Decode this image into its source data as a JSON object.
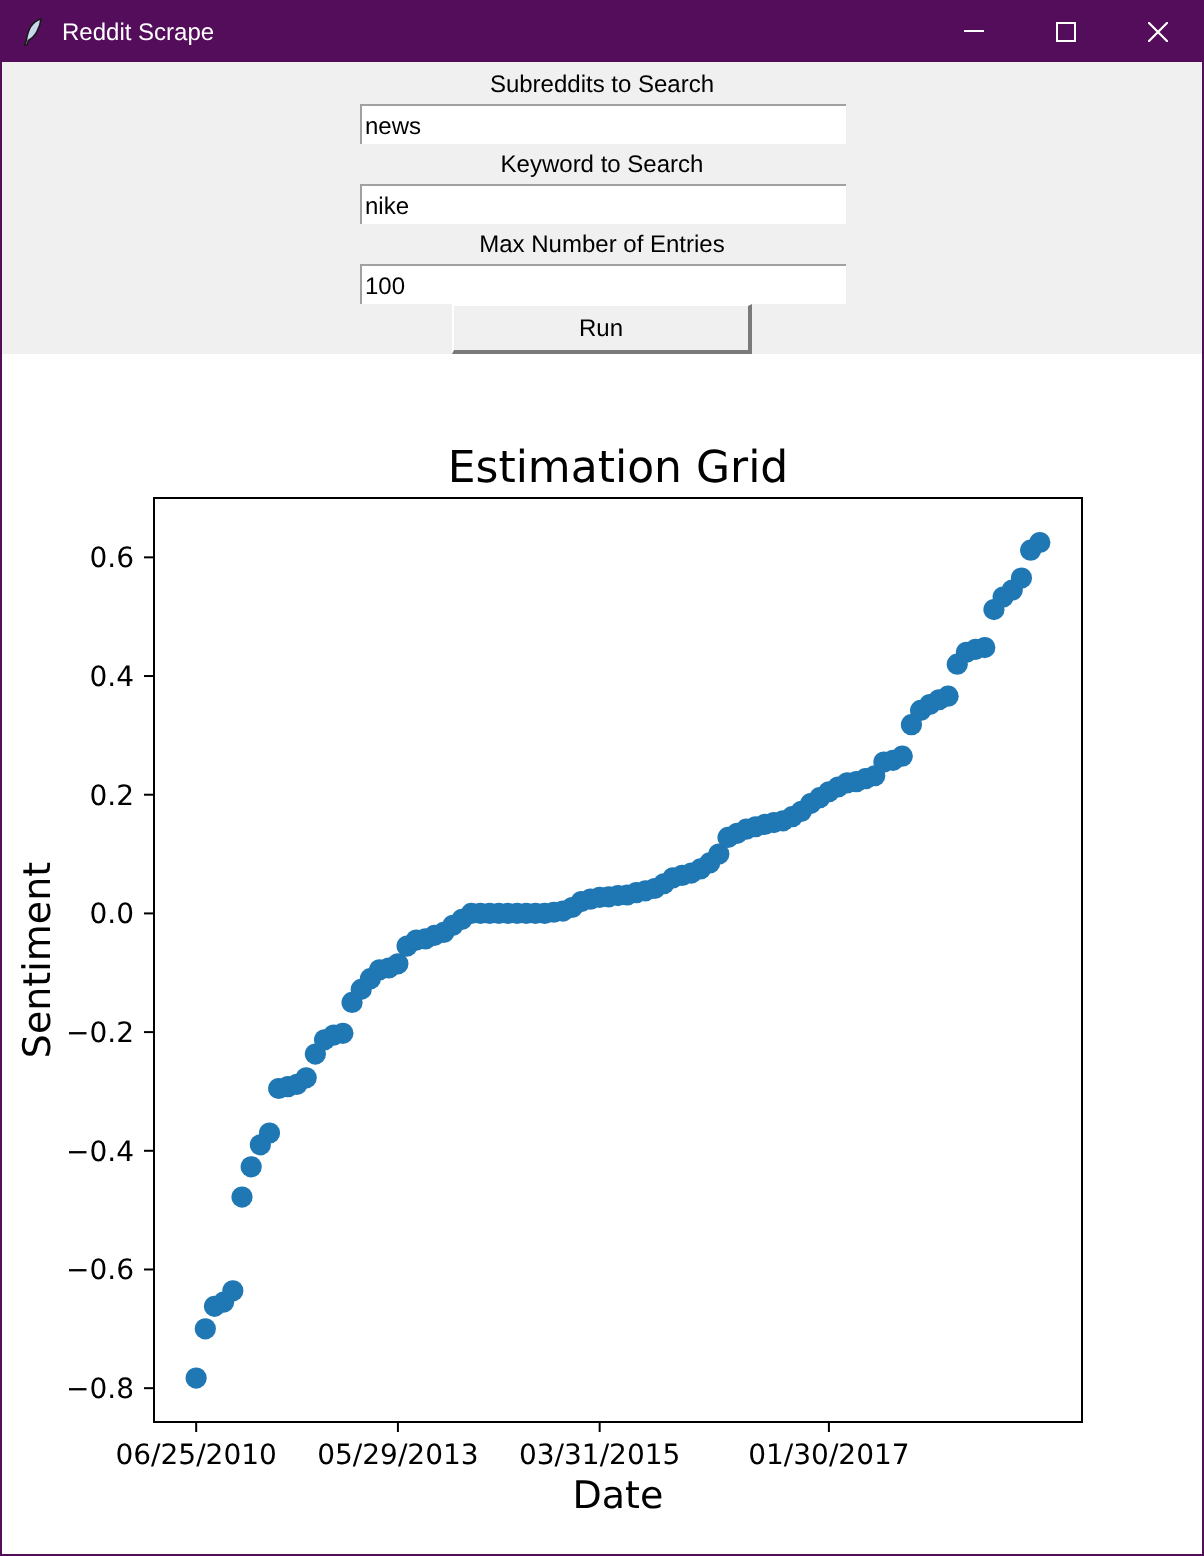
{
  "window": {
    "title": "Reddit Scrape"
  },
  "form": {
    "fields": [
      {
        "label": "Subreddits to Search",
        "value": "news"
      },
      {
        "label": "Keyword to Search",
        "value": "nike"
      },
      {
        "label": "Max Number of Entries",
        "value": "100"
      }
    ],
    "run_button": "Run"
  },
  "chart": {
    "chart_data": {
      "type": "scatter",
      "title": "Estimation Grid",
      "xlabel": "Date",
      "ylabel": "Sentiment",
      "categories": [
        "06/25/2010",
        null,
        null,
        null,
        null,
        null,
        null,
        null,
        null,
        null,
        null,
        null,
        null,
        null,
        null,
        null,
        null,
        null,
        null,
        null,
        null,
        null,
        "05/29/2013",
        null,
        null,
        null,
        null,
        null,
        null,
        null,
        null,
        null,
        null,
        null,
        null,
        null,
        null,
        null,
        null,
        null,
        null,
        null,
        null,
        null,
        "03/31/2015",
        null,
        null,
        null,
        null,
        null,
        null,
        null,
        null,
        null,
        null,
        null,
        null,
        null,
        null,
        null,
        null,
        null,
        null,
        null,
        null,
        null,
        null,
        null,
        null,
        "01/30/2017",
        null,
        null,
        null,
        null,
        null,
        null,
        null,
        null,
        null,
        null,
        null,
        null,
        null,
        null,
        null,
        null,
        null,
        null,
        null,
        null,
        null,
        null,
        null
      ],
      "series": [
        {
          "color": "#1f77b4",
          "values": [
            -0.783,
            -0.7,
            -0.662,
            -0.655,
            -0.636,
            -0.478,
            -0.427,
            -0.39,
            -0.37,
            -0.295,
            -0.292,
            -0.288,
            -0.277,
            -0.237,
            -0.213,
            -0.205,
            -0.202,
            -0.15,
            -0.128,
            -0.11,
            -0.095,
            -0.092,
            -0.085,
            -0.055,
            -0.045,
            -0.043,
            -0.037,
            -0.032,
            -0.02,
            -0.01,
            0.0,
            0.0,
            0.0,
            0.0,
            0.0,
            0.0,
            0.0,
            0.0,
            0.0,
            0.002,
            0.004,
            0.01,
            0.02,
            0.024,
            0.027,
            0.028,
            0.03,
            0.031,
            0.035,
            0.038,
            0.042,
            0.05,
            0.06,
            0.064,
            0.068,
            0.075,
            0.085,
            0.1,
            0.128,
            0.135,
            0.142,
            0.146,
            0.15,
            0.153,
            0.156,
            0.163,
            0.172,
            0.185,
            0.195,
            0.205,
            0.213,
            0.22,
            0.222,
            0.227,
            0.232,
            0.255,
            0.258,
            0.265,
            0.318,
            0.342,
            0.352,
            0.36,
            0.366,
            0.42,
            0.44,
            0.445,
            0.448,
            0.512,
            0.533,
            0.545,
            0.565,
            0.612,
            0.625
          ]
        }
      ],
      "ylim": [
        -0.857,
        0.7
      ],
      "yticks": [
        {
          "value": -0.8,
          "label": "−0.8"
        },
        {
          "value": -0.6,
          "label": "−0.6"
        },
        {
          "value": -0.4,
          "label": "−0.4"
        },
        {
          "value": -0.2,
          "label": "−0.2"
        },
        {
          "value": 0,
          "label": "0.0"
        },
        {
          "value": 0.2,
          "label": "0.2"
        },
        {
          "value": 0.4,
          "label": "0.4"
        },
        {
          "value": 0.6,
          "label": "0.6"
        }
      ]
    }
  }
}
